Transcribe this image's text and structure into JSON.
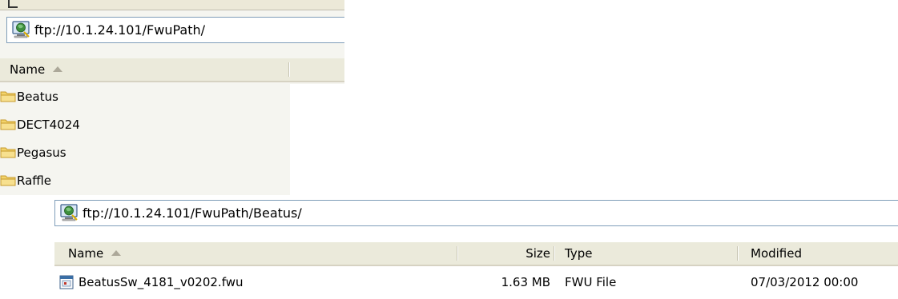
{
  "colors": {
    "folder_fill": "#f2d36b",
    "folder_edge": "#c79a2b",
    "header_bg": "#ebeadb",
    "address_border": "#7f9db9"
  },
  "window_top": {
    "address": {
      "icon": "ftp-globe-icon",
      "url": "ftp://10.1.24.101/FwuPath/"
    },
    "columns": [
      {
        "label": "Name",
        "sorted": "ascending"
      }
    ],
    "items": [
      {
        "label": "Beatus",
        "icon": "folder-icon"
      },
      {
        "label": "DECT4024",
        "icon": "folder-icon"
      },
      {
        "label": "Pegasus",
        "icon": "folder-icon"
      },
      {
        "label": "Raffle",
        "icon": "folder-icon"
      }
    ]
  },
  "window_bottom": {
    "address": {
      "icon": "ftp-globe-icon",
      "url": "ftp://10.1.24.101/FwuPath/Beatus/"
    },
    "columns": [
      {
        "label": "Name",
        "sorted": "ascending"
      },
      {
        "label": "Size"
      },
      {
        "label": "Type"
      },
      {
        "label": "Modified"
      }
    ],
    "files": [
      {
        "name": "BeatusSw_4181_v0202.fwu",
        "icon": "fwu-file-icon",
        "size": "1.63 MB",
        "type": "FWU File",
        "modified": "07/03/2012 00:00"
      }
    ]
  }
}
